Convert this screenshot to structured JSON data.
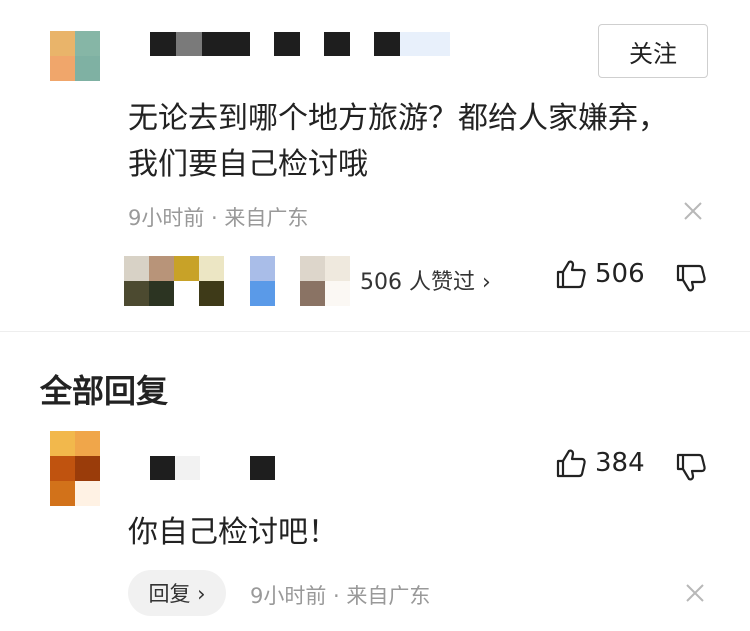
{
  "comment": {
    "follow_label": "关注",
    "text": "无论去到哪个地方旅游？都给人家嫌弃，我们要自己检讨哦",
    "meta": "9小时前 · 来自广东",
    "likers_summary": "506 人赞过 ›",
    "like_count": "506"
  },
  "replies_section": {
    "title": "全部回复"
  },
  "reply": {
    "text": "你自己检讨吧！",
    "like_count": "384",
    "reply_label": "回复 ›",
    "meta": "9小时前 · 来自广东"
  },
  "icons": {
    "close": "close-icon",
    "thumbs_up": "thumbs-up-icon",
    "thumbs_down": "thumbs-down-icon"
  },
  "colors": {
    "meta_text": "#999999",
    "divider": "#eeeeee",
    "pill_bg": "#f1f1f1"
  }
}
